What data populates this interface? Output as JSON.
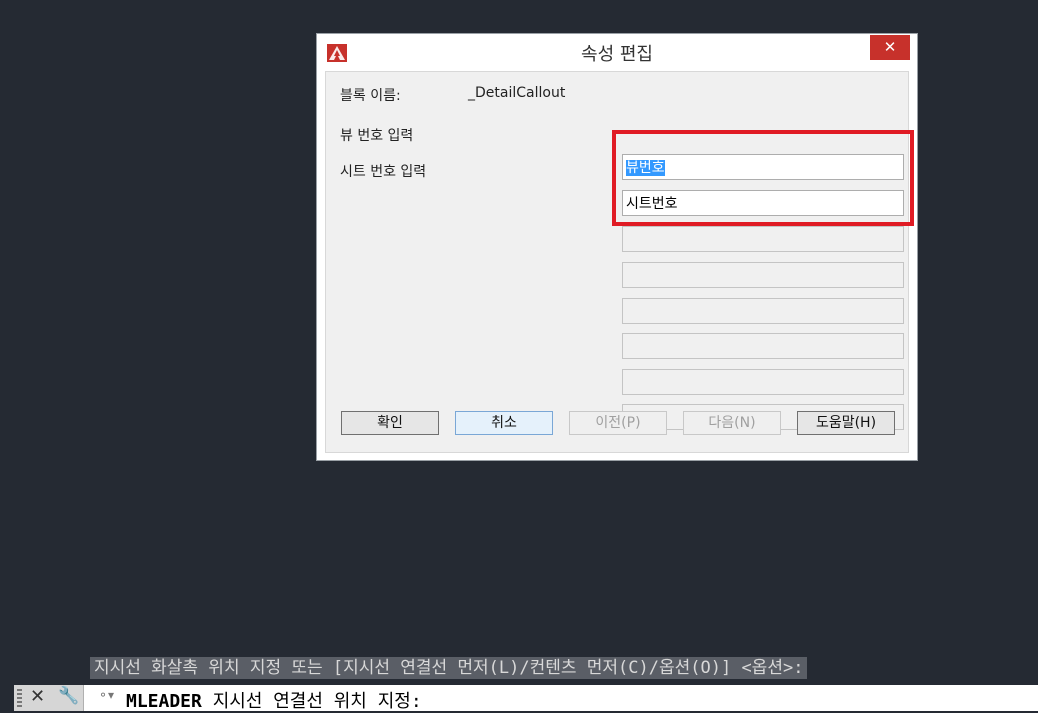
{
  "dialog": {
    "title": "속성 편집",
    "close_glyph": "✕",
    "block_name_label": "블록 이름:",
    "block_name_value": "_DetailCallout",
    "fields": [
      {
        "label": "뷰 번호 입력",
        "value": "뷰번호"
      },
      {
        "label": "시트 번호 입력",
        "value": "시트번호"
      }
    ],
    "buttons": {
      "ok": "확인",
      "cancel": "취소",
      "prev": "이전(P)",
      "next": "다음(N)",
      "help": "도움말(H)"
    }
  },
  "command": {
    "history_line": "지시선 화살촉 위치 지정 또는 [지시선 연결선 먼저(L)/컨텐츠 먼저(C)/옵션(O)] <옵션>:",
    "keyword": "MLEADER",
    "prompt": "지시선 연결선 위치 지정:"
  },
  "icons": {
    "app": "autocad-logo-icon",
    "close": "close-icon",
    "wrench": "wrench-icon",
    "recent": "recent-commands-icon",
    "grip": "grip-handle-icon"
  },
  "colors": {
    "highlight": "#e01b24",
    "close_button": "#c7312b",
    "selection": "#3399ff",
    "canvas": "#252a33"
  }
}
